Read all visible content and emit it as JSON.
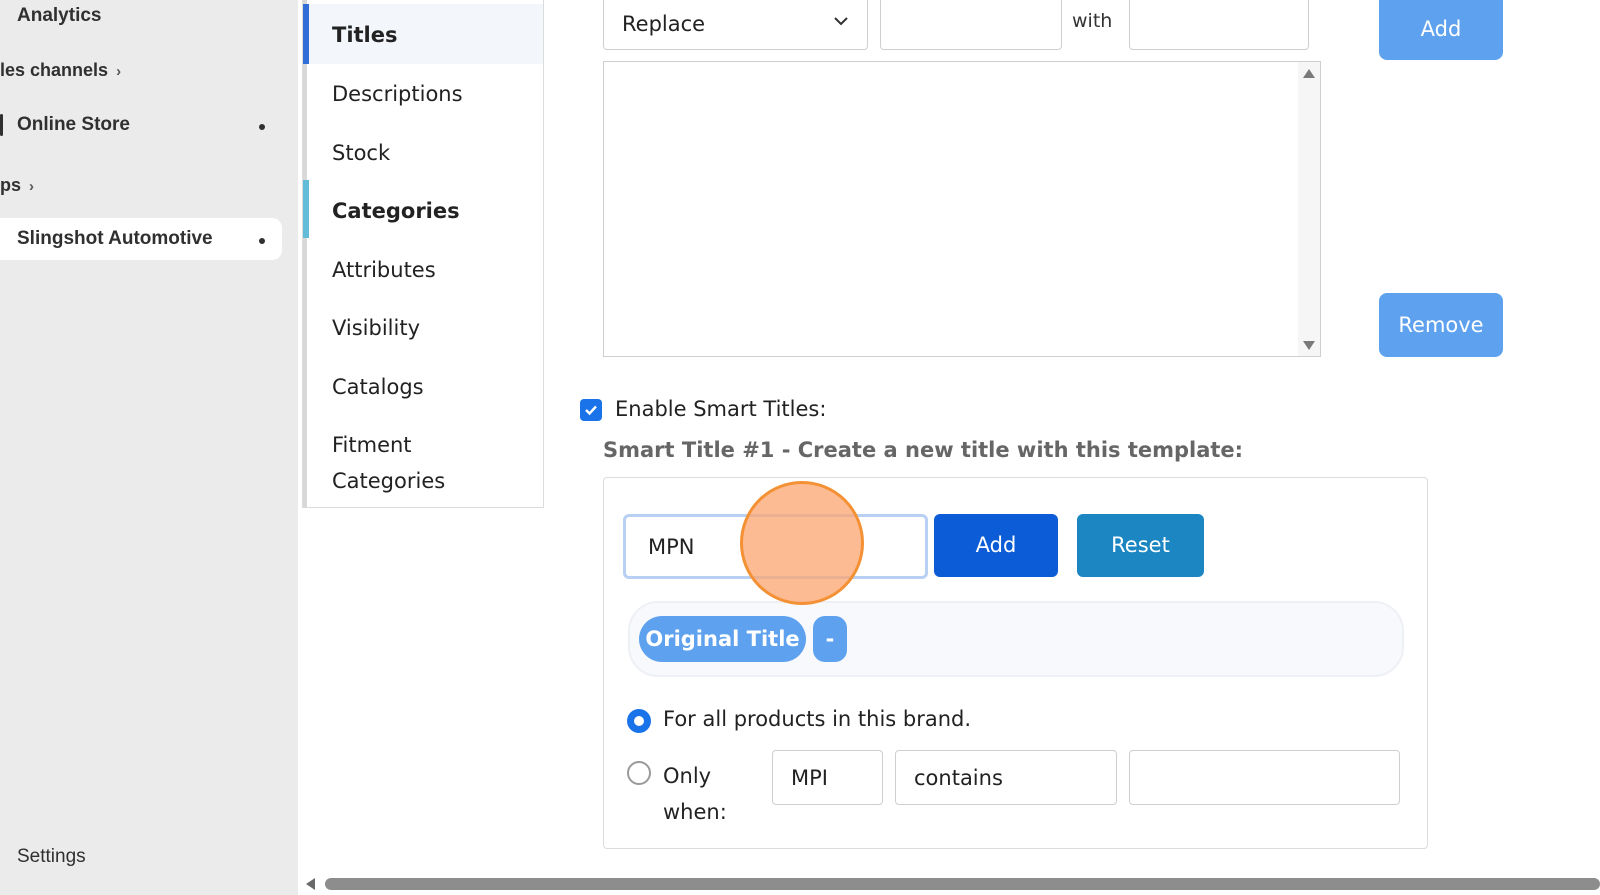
{
  "sidebar": {
    "items": [
      {
        "label": "Analytics"
      },
      {
        "label": "les channels"
      },
      {
        "label": "Online Store"
      },
      {
        "label": "ps"
      },
      {
        "label": "Slingshot Automotive"
      }
    ],
    "settings_label": "Settings"
  },
  "section_nav": {
    "items": [
      {
        "label": "Titles"
      },
      {
        "label": "Descriptions"
      },
      {
        "label": "Stock"
      },
      {
        "label": "Categories"
      },
      {
        "label": "Attributes"
      },
      {
        "label": "Visibility"
      },
      {
        "label": "Catalogs"
      },
      {
        "label": "Fitment Categories"
      }
    ]
  },
  "replace_rule": {
    "action_selected": "Replace",
    "with_label": "with",
    "add_label": "Add",
    "remove_label": "Remove"
  },
  "smart_titles": {
    "enable_label": "Enable Smart Titles:",
    "enabled": true,
    "template_label": "Smart Title #1 - Create a new title with this template:",
    "token_input_value": "MPN",
    "add_label": "Add",
    "reset_label": "Reset",
    "tokens": [
      "Original Title",
      "-"
    ],
    "scope_all_label": "For all products in this brand.",
    "scope_only_label": "Only when:",
    "condition_field": "MPI",
    "condition_operator": "contains",
    "condition_value": ""
  },
  "colors": {
    "primary": "#0b5cd6",
    "light_blue": "#5ea2ef",
    "teal": "#1b86c2",
    "click_highlight": "#f39134"
  }
}
